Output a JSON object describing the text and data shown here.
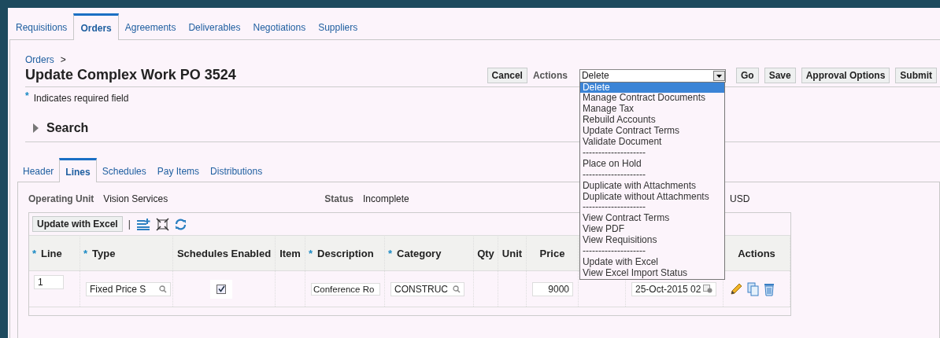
{
  "tabs": [
    {
      "label": "Requisitions",
      "selected": false
    },
    {
      "label": "Orders",
      "selected": true
    },
    {
      "label": "Agreements",
      "selected": false
    },
    {
      "label": "Deliverables",
      "selected": false
    },
    {
      "label": "Negotiations",
      "selected": false
    },
    {
      "label": "Suppliers",
      "selected": false
    }
  ],
  "breadcrumb": {
    "link": "Orders",
    "separator": ">"
  },
  "page_title": "Update Complex Work PO 3524",
  "required_note": {
    "mark": "*",
    "text": "Indicates required field"
  },
  "actions_bar": {
    "cancel": {
      "label": "Cancel"
    },
    "actions_label": "Actions",
    "select_value": "Delete",
    "buttons": [
      {
        "label": "Go"
      },
      {
        "label": "Save"
      },
      {
        "label": "Approval Options"
      },
      {
        "label": "Submit"
      }
    ]
  },
  "dropdown": [
    {
      "kind": "option",
      "label": "Delete",
      "selected": true
    },
    {
      "kind": "option",
      "label": "Manage Contract Documents",
      "selected": false
    },
    {
      "kind": "option",
      "label": "Manage Tax",
      "selected": false
    },
    {
      "kind": "option",
      "label": "Rebuild Accounts",
      "selected": false
    },
    {
      "kind": "option",
      "label": "Update Contract Terms",
      "selected": false
    },
    {
      "kind": "option",
      "label": "Validate Document",
      "selected": false
    },
    {
      "kind": "separator",
      "label": "--------------------"
    },
    {
      "kind": "option",
      "label": "Place on Hold",
      "selected": false
    },
    {
      "kind": "separator",
      "label": "--------------------"
    },
    {
      "kind": "option",
      "label": "Duplicate with Attachments",
      "selected": false
    },
    {
      "kind": "option",
      "label": "Duplicate without Attachments",
      "selected": false
    },
    {
      "kind": "separator",
      "label": "--------------------"
    },
    {
      "kind": "option",
      "label": "View Contract Terms",
      "selected": false
    },
    {
      "kind": "option",
      "label": "View PDF",
      "selected": false
    },
    {
      "kind": "option",
      "label": "View Requisitions",
      "selected": false
    },
    {
      "kind": "separator",
      "label": "--------------------"
    },
    {
      "kind": "option",
      "label": "Update with Excel",
      "selected": false
    },
    {
      "kind": "option",
      "label": "View Excel Import Status",
      "selected": false
    }
  ],
  "search_section": {
    "title": "Search",
    "expanded": false
  },
  "sub_tabs": [
    {
      "label": "Header",
      "selected": false
    },
    {
      "label": "Lines",
      "selected": true
    },
    {
      "label": "Schedules",
      "selected": false
    },
    {
      "label": "Pay Items",
      "selected": false
    },
    {
      "label": "Distributions",
      "selected": false
    }
  ],
  "info": {
    "operating_unit_label": "Operating Unit",
    "operating_unit": "Vision Services",
    "status_label": "Status",
    "status": "Incomplete",
    "currency": "USD"
  },
  "table": {
    "toolbar_button": "Update with Excel",
    "toolbar_separator": "|",
    "columns": [
      {
        "label": "Line",
        "required": true
      },
      {
        "label": "Type",
        "required": true
      },
      {
        "label": "Schedules Enabled",
        "required": false
      },
      {
        "label": "Item",
        "required": false
      },
      {
        "label": "Description",
        "required": true
      },
      {
        "label": "Category",
        "required": true
      },
      {
        "label": "Qty",
        "required": false
      },
      {
        "label": "Unit",
        "required": false
      },
      {
        "label": "Price",
        "required": false
      }
    ],
    "actions_header": "Actions",
    "rows": [
      {
        "line": "1",
        "type": "Fixed Price S",
        "schedules_enabled": true,
        "description": "Conference Ro",
        "category": "CONSTRUC",
        "price": "9000",
        "column_11": "25-Oct-2015 02"
      }
    ]
  }
}
